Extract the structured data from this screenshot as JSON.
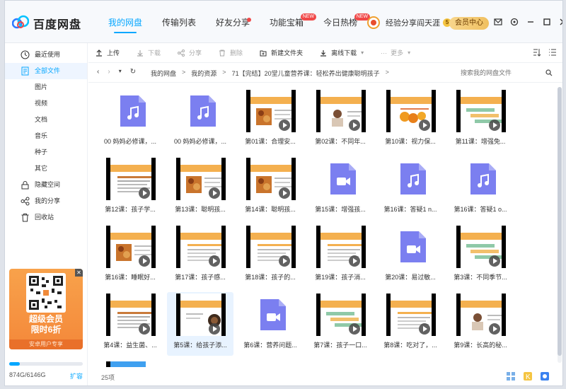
{
  "app": {
    "brand": "百度网盘"
  },
  "nav": [
    {
      "label": "我的网盘",
      "active": true
    },
    {
      "label": "传输列表"
    },
    {
      "label": "好友分享",
      "dot": true
    },
    {
      "label": "功能宝箱",
      "badge": "NEW"
    },
    {
      "label": "今日热榜",
      "badge": "NEW"
    }
  ],
  "user": {
    "name": "经验分享阎天涯",
    "level": "5",
    "member_label": "会员中心"
  },
  "sidebar": {
    "items": [
      {
        "label": "最近使用",
        "icon": "clock-icon"
      },
      {
        "label": "全部文件",
        "icon": "file-list-icon",
        "active": true
      },
      {
        "label": "图片",
        "sub": true
      },
      {
        "label": "视频",
        "sub": true
      },
      {
        "label": "文档",
        "sub": true
      },
      {
        "label": "音乐",
        "sub": true
      },
      {
        "label": "种子",
        "sub": true
      },
      {
        "label": "其它",
        "sub": true
      },
      {
        "label": "隐藏空间",
        "icon": "lock-icon"
      },
      {
        "label": "我的分享",
        "icon": "share-icon"
      },
      {
        "label": "回收站",
        "icon": "trash-icon"
      }
    ],
    "ad": {
      "title_line1": "超级会员",
      "title_line2": "限时6折",
      "footer": "安卓用户专享"
    },
    "quota": {
      "text": "874G/6146G",
      "expand": "扩容",
      "used_fraction": 0.142
    }
  },
  "toolbar": {
    "upload": "上传",
    "download": "下载",
    "share": "分享",
    "delete": "删除",
    "new_folder": "新建文件夹",
    "offline": "离线下载",
    "more": "更多"
  },
  "path": {
    "crumbs": [
      "我的网盘",
      "我的资源",
      "71【完结】20堂儿童营养课：轻松养出健康聪明孩子"
    ],
    "search_placeholder": "搜索我的网盘文件"
  },
  "files": [
    {
      "name": "00 妈妈必修课，...",
      "kind": "audio"
    },
    {
      "name": "00 妈妈必修课，...",
      "kind": "audio"
    },
    {
      "name": "第01课：合理安...",
      "kind": "video",
      "theme": "food"
    },
    {
      "name": "第02课：不同年...",
      "kind": "video",
      "theme": "person"
    },
    {
      "name": "第10课：视力保...",
      "kind": "video",
      "theme": "fruit"
    },
    {
      "name": "第11课：增强免...",
      "kind": "video",
      "theme": "steps"
    },
    {
      "name": "第12课：孩子学...",
      "kind": "video",
      "theme": "book"
    },
    {
      "name": "第13课：聪明孩...",
      "kind": "video",
      "theme": "food"
    },
    {
      "name": "第14课：聪明孩...",
      "kind": "video",
      "theme": "food"
    },
    {
      "name": "第15课：增强孩...",
      "kind": "videofile"
    },
    {
      "name": "第16课：答疑1 n...",
      "kind": "audio"
    },
    {
      "name": "第16课：答疑1 o...",
      "kind": "audio"
    },
    {
      "name": "第16课：睡眠好...",
      "kind": "video",
      "theme": "food"
    },
    {
      "name": "第17课：孩子感...",
      "kind": "video",
      "theme": "text"
    },
    {
      "name": "第18课：孩子的...",
      "kind": "video",
      "theme": "text"
    },
    {
      "name": "第19课：孩子消...",
      "kind": "video",
      "theme": "text"
    },
    {
      "name": "第20课：易过敏...",
      "kind": "videofile"
    },
    {
      "name": "第3课：不同季节...",
      "kind": "video",
      "theme": "steps"
    },
    {
      "name": "第4课：益生菌、...",
      "kind": "video",
      "theme": "book"
    },
    {
      "name": "第5课：给孩子添...",
      "kind": "video",
      "theme": "coffee",
      "selected": true
    },
    {
      "name": "第6课：营养问题...",
      "kind": "videofile"
    },
    {
      "name": "第7课：孩子一口...",
      "kind": "video",
      "theme": "steps"
    },
    {
      "name": "第8课：吃对了，...",
      "kind": "video",
      "theme": "text"
    },
    {
      "name": "第9课：长高的秘...",
      "kind": "video",
      "theme": "person"
    }
  ],
  "status": {
    "count": "25项"
  },
  "colors": {
    "accent": "#06a7ff",
    "file_icon": "#7b7ff0",
    "thumb_orange": "#f4b04f"
  }
}
